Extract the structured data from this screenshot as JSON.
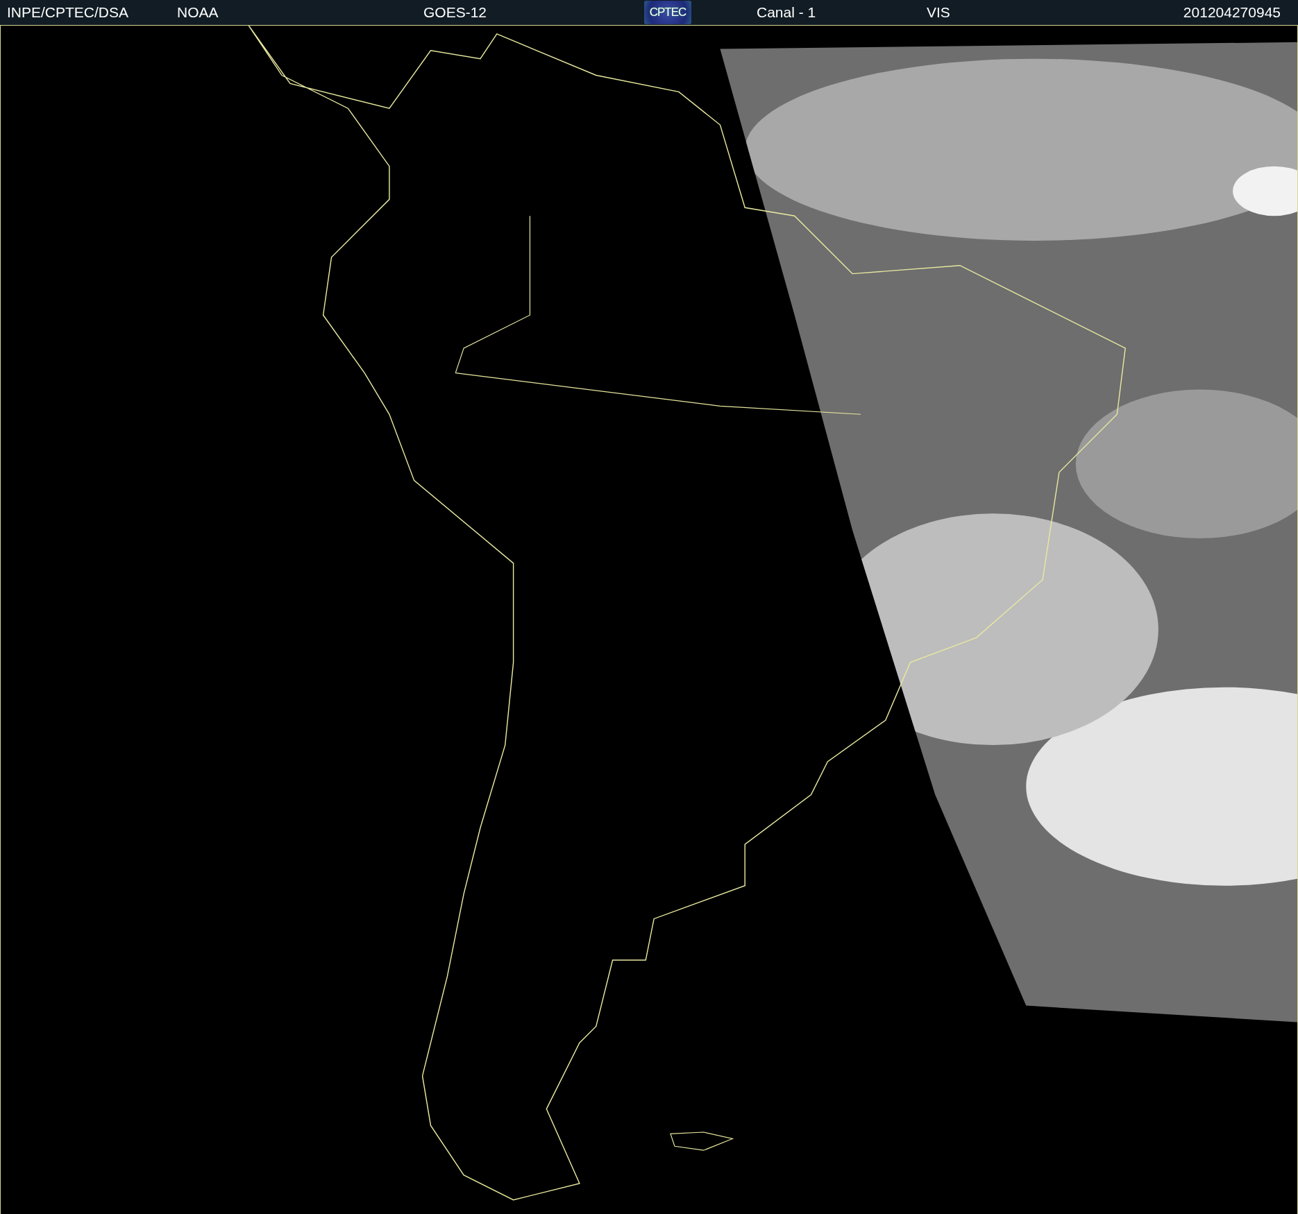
{
  "header": {
    "source": "INPE/CPTEC/DSA",
    "agency": "NOAA",
    "satellite": "GOES-12",
    "logo": "CPTEC",
    "channel": "Canal - 1",
    "band": "VIS",
    "timestamp": "201204270945"
  }
}
